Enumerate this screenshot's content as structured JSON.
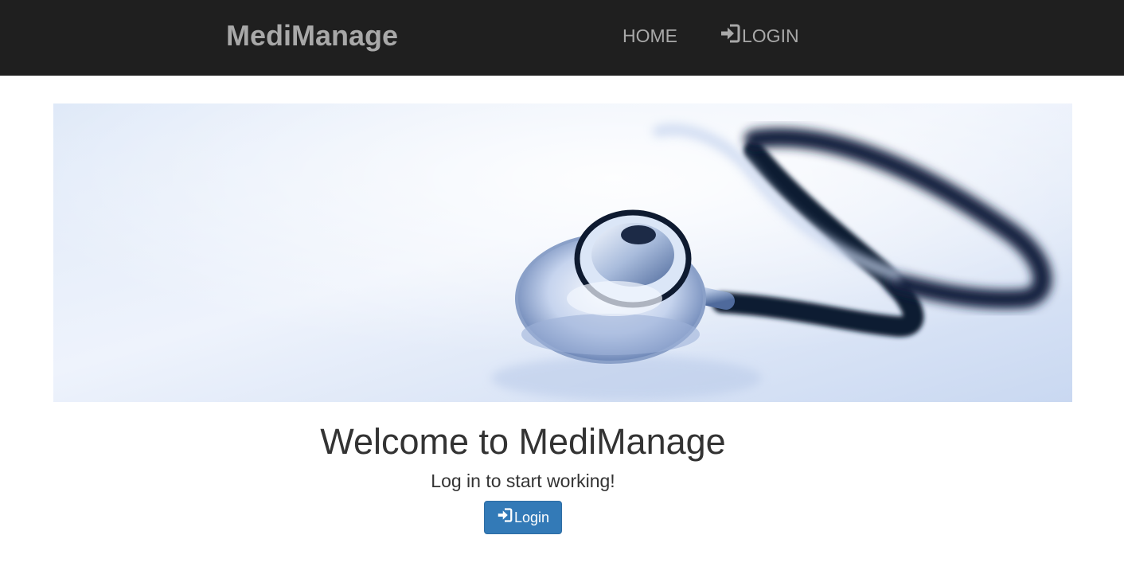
{
  "navbar": {
    "brand": "MediManage",
    "items": [
      {
        "label": "HOME"
      },
      {
        "label": "LOGIN",
        "icon": "log-in-icon"
      }
    ]
  },
  "hero": {
    "image": "stethoscope-banner"
  },
  "main": {
    "title": "Welcome to MediManage",
    "subtitle": "Log in to start working!",
    "login_button": {
      "label": "Login",
      "icon": "log-in-icon"
    }
  },
  "colors": {
    "navbar_bg": "#1f1f1f",
    "nav_text": "#a8a8a8",
    "primary_button": "#337ab7"
  }
}
